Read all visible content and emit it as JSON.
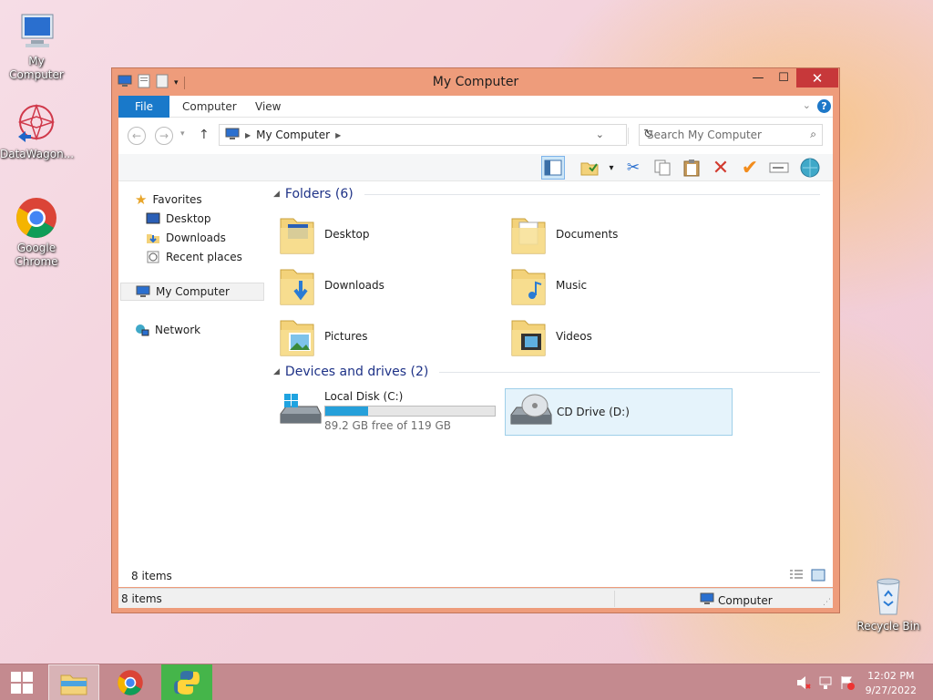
{
  "desktop": {
    "icons": [
      {
        "label": "My Computer"
      },
      {
        "label": "DataWagon..."
      },
      {
        "label": "Google Chrome"
      },
      {
        "label": "Recycle Bin"
      }
    ]
  },
  "window": {
    "title": "My Computer",
    "ribbon_tabs": [
      "File",
      "Computer",
      "View"
    ],
    "address": "My Computer",
    "search_placeholder": "Search My Computer"
  },
  "nav": {
    "favorites": "Favorites",
    "desktop": "Desktop",
    "downloads": "Downloads",
    "recent": "Recent places",
    "mycomputer": "My Computer",
    "network": "Network"
  },
  "main": {
    "folders_header": "Folders (6)",
    "folders": [
      "Desktop",
      "Documents",
      "Downloads",
      "Music",
      "Pictures",
      "Videos"
    ],
    "devices_header": "Devices and drives (2)",
    "drives": [
      {
        "name": "Local Disk (C:)",
        "free_text": "89.2 GB free of 119 GB",
        "used_fraction": 0.25
      },
      {
        "name": "CD Drive (D:)"
      }
    ]
  },
  "status": {
    "inner_items": "8 items",
    "outer_items": "8 items",
    "location": "Computer"
  },
  "taskbar": {
    "time": "12:02 PM",
    "date": "9/27/2022"
  },
  "colors": {
    "window_frame": "#ee9c7b",
    "close_button": "#c7383a",
    "file_tab": "#1979ca",
    "disk_bar": "#26a0da",
    "taskbar": "#c48a8f"
  }
}
